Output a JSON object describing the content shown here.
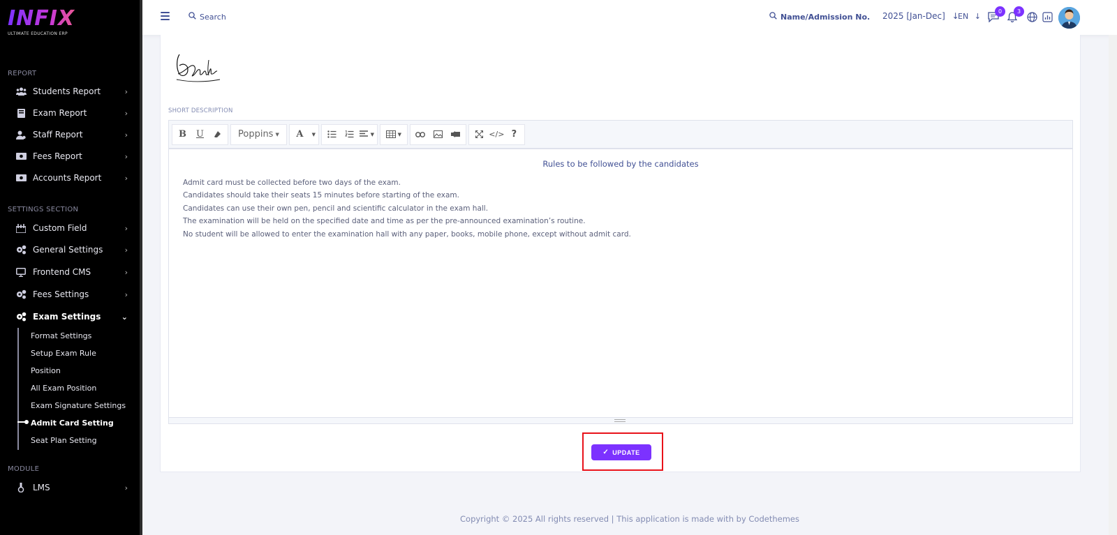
{
  "brand": {
    "word": "INFIX",
    "tagline": "ULTIMATE EDUCATION ERP"
  },
  "sidebar": {
    "sections": [
      {
        "title": "REPORT"
      },
      {
        "title": "SETTINGS SECTION"
      },
      {
        "title": "MODULE"
      }
    ],
    "report_items": [
      {
        "label": "Students Report",
        "icon": "users-icon"
      },
      {
        "label": "Exam Report",
        "icon": "book-icon"
      },
      {
        "label": "Staff Report",
        "icon": "user-icon"
      },
      {
        "label": "Fees Report",
        "icon": "money-icon"
      },
      {
        "label": "Accounts Report",
        "icon": "money-icon"
      }
    ],
    "settings_items": [
      {
        "label": "Custom Field",
        "icon": "form-icon"
      },
      {
        "label": "General Settings",
        "icon": "gears-icon"
      },
      {
        "label": "Frontend CMS",
        "icon": "monitor-icon"
      },
      {
        "label": "Fees Settings",
        "icon": "gears-icon"
      },
      {
        "label": "Exam Settings",
        "icon": "gears-icon"
      }
    ],
    "exam_sub_items": [
      {
        "label": "Format Settings"
      },
      {
        "label": "Setup Exam Rule"
      },
      {
        "label": "Position"
      },
      {
        "label": "All Exam Position"
      },
      {
        "label": "Exam Signature Settings"
      },
      {
        "label": "Admit Card Setting"
      },
      {
        "label": "Seat Plan Setting"
      }
    ],
    "module_items": [
      {
        "label": "LMS",
        "icon": "lms-icon"
      }
    ],
    "chevron": "›",
    "chevron_open": "⌄"
  },
  "topbar": {
    "search_label": "Search",
    "admission_search_label": "Name/Admission No.",
    "session": "2025 [Jan-Dec]",
    "language": "EN",
    "chat_count": "0",
    "notification_count": "3"
  },
  "form": {
    "short_description_label": "SHORT DESCRIPTION",
    "toolbar": {
      "font_name": "Poppins"
    },
    "editor": {
      "heading": "Rules to be followed by the candidates",
      "rules": [
        "Admit card must be collected before two days of the exam.",
        "Candidates should take their seats 15 minutes before starting of the exam.",
        "Candidates can use their own pen, pencil and scientific calculator in the exam hall.",
        "The examination will be held on the specified date and time as per the pre-announced examination’s routine.",
        "No student will be allowed to enter the examination hall with any paper, books, mobile phone, except without admit card."
      ]
    },
    "update_label": "UPDATE"
  },
  "footer": {
    "text": "Copyright © 2025 All rights reserved | This application is made with by Codethemes"
  },
  "colors": {
    "accent": "#7c32ff",
    "highlight": "#e8121a",
    "text": "#415094"
  }
}
